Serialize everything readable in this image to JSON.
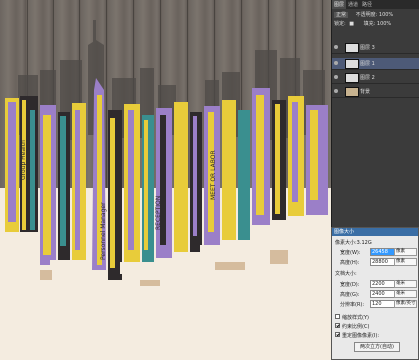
{
  "panel": {
    "tabs": [
      "图层",
      "通道",
      "路径"
    ],
    "blend_mode": "正常",
    "opacity_label": "不透明度:",
    "opacity_value": "100%",
    "lock_label": "锁定:",
    "fill_label": "填充:",
    "fill_value": "100%",
    "layers": [
      {
        "name": "图层 3",
        "selected": false
      },
      {
        "name": "图层 1",
        "selected": true
      },
      {
        "name": "图层 2",
        "selected": false
      },
      {
        "name": "背景",
        "selected": false
      }
    ]
  },
  "dialog": {
    "title": "图像大小",
    "pixel_size_label": "像素大小:3.12G",
    "width_label": "宽度(W):",
    "width_value": "26458",
    "width_unit": "像素",
    "height_label": "高度(H):",
    "height_value": "28800",
    "height_unit": "像素",
    "doc_size_label": "文档大小:",
    "doc_width_label": "宽度(D):",
    "doc_width_value": "2200",
    "doc_width_unit": "毫米",
    "doc_height_label": "高度(G):",
    "doc_height_value": "2400",
    "doc_height_unit": "毫米",
    "resolution_label": "分辨率(R):",
    "resolution_value": "120",
    "resolution_unit": "像素/英寸",
    "scale_styles_label": "缩放样式(Y)",
    "constrain_label": "约束比例(C)",
    "resample_label": "重定图像像素(I):",
    "resample_method": "两次立方(自动)",
    "scale_styles_checked": false,
    "constrain_checked": true,
    "resample_checked": true
  },
  "colors": {
    "panel_bg": "#3b3b3b",
    "selected_layer": "#4d5a77",
    "dialog_bg": "#e9e9e9",
    "highlight": "#3399ff",
    "city_yellow": "#e8cc3a",
    "city_purple": "#9b7fc8",
    "city_teal": "#3a8f8f"
  }
}
